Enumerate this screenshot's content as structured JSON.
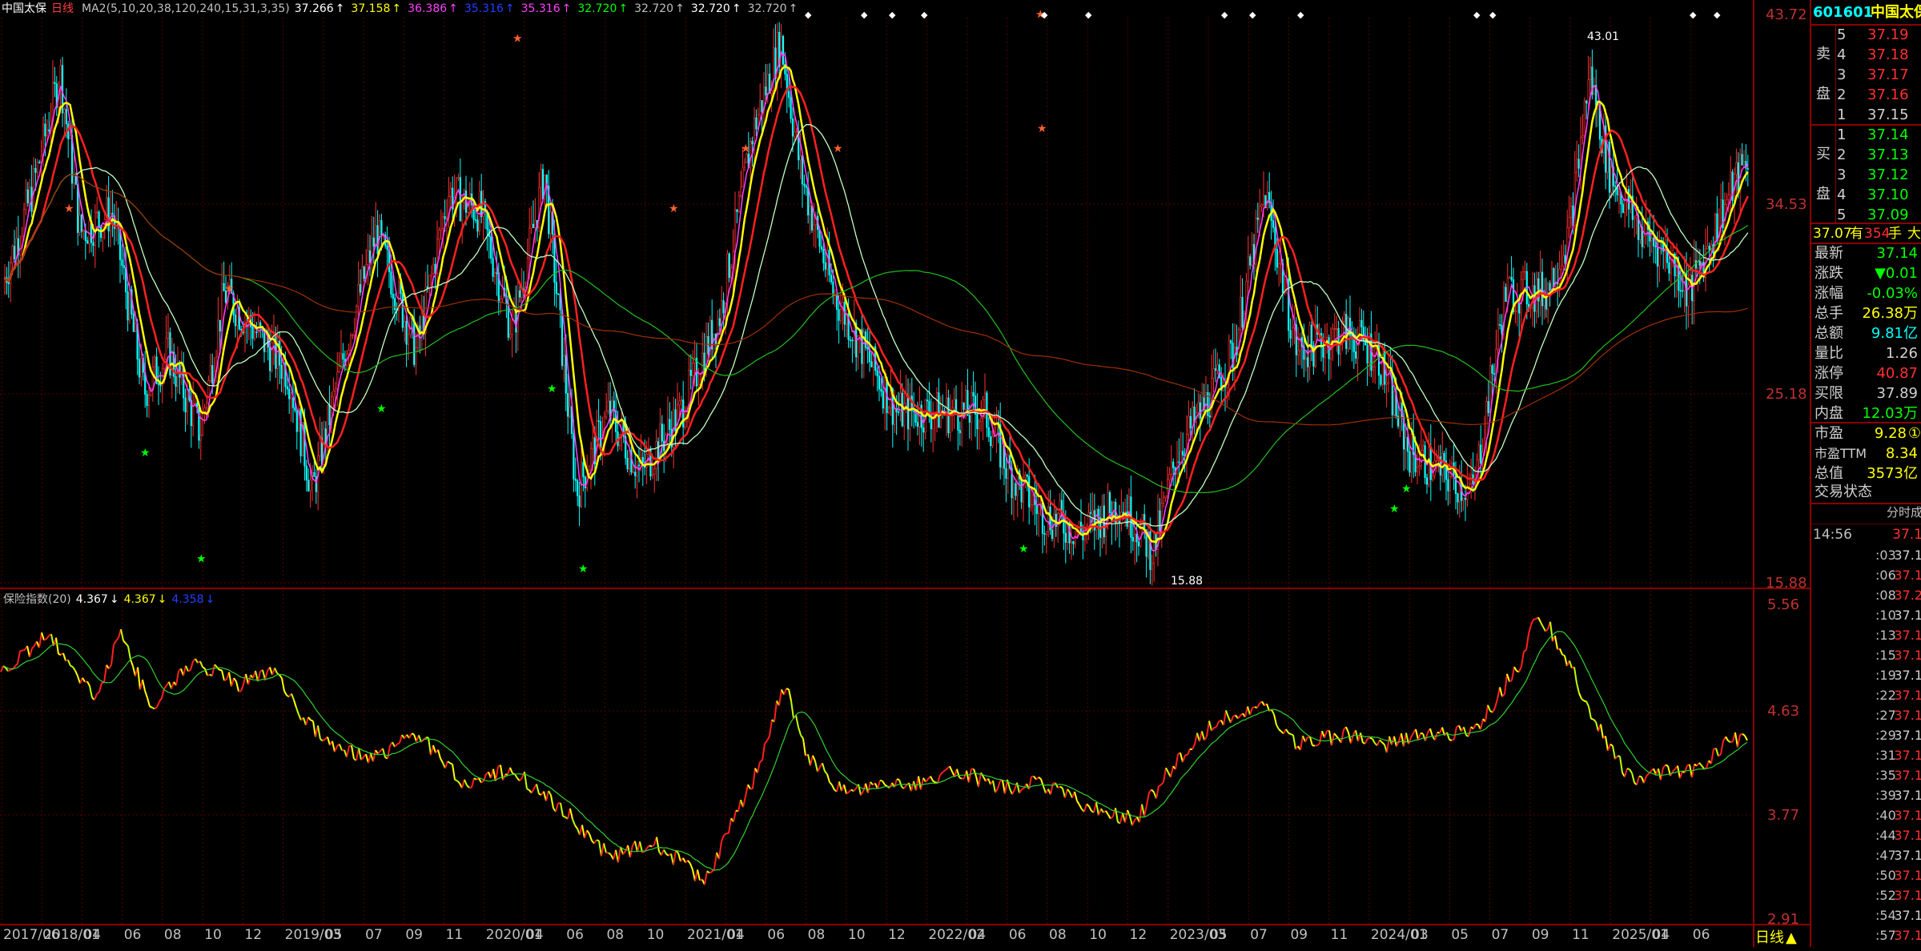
{
  "header": {
    "stock_name": "中国太保",
    "period": "日线",
    "ma_label": "MA2(5,10,20,38,120,240,15,31,3,35)",
    "ma_values": [
      {
        "value": "37.266",
        "color": "#ffffff"
      },
      {
        "value": "37.158",
        "color": "#ffff00"
      },
      {
        "value": "36.386",
        "color": "#ff40ff"
      },
      {
        "value": "35.316",
        "color": "#2040ff"
      },
      {
        "value": "35.316",
        "color": "#ff40ff"
      },
      {
        "value": "32.720",
        "color": "#00ff00"
      },
      {
        "value": "32.720",
        "color": "#c0c0c0"
      },
      {
        "value": "32.720",
        "color": "#ffffff"
      },
      {
        "value": "32.720",
        "color": "#c0c0c0"
      }
    ]
  },
  "price_axis": {
    "labels": [
      "43.72",
      "34.53",
      "25.18",
      "15.88"
    ]
  },
  "annotations": {
    "high": "43.01",
    "low": "15.88"
  },
  "index_panel": {
    "title": "保险指数(20)",
    "values": [
      {
        "value": "4.367",
        "color": "#ffffff"
      },
      {
        "value": "4.367",
        "color": "#ffff00"
      },
      {
        "value": "4.358",
        "color": "#2040ff"
      }
    ],
    "axis_labels": [
      "5.56",
      "4.63",
      "3.77",
      "2.91"
    ]
  },
  "x_axis": {
    "labels": [
      "2017/06",
      "2018/01",
      "04",
      "06",
      "08",
      "10",
      "12",
      "2019/03",
      "05",
      "07",
      "09",
      "11",
      "2020/01",
      "04",
      "06",
      "08",
      "10",
      "2021/01",
      "04",
      "06",
      "08",
      "10",
      "12",
      "2022/02",
      "04",
      "06",
      "08",
      "10",
      "12",
      "2023/03",
      "05",
      "07",
      "09",
      "11",
      "2024/01",
      "03",
      "05",
      "07",
      "09",
      "11",
      "2025/01",
      "04",
      "06"
    ]
  },
  "period_toggle": "日线",
  "quote": {
    "code": "601601",
    "name": "中国太保",
    "sell_label": [
      "卖",
      "盘"
    ],
    "buy_label": [
      "买",
      "盘"
    ],
    "sells": [
      {
        "level": "5",
        "price": "37.19"
      },
      {
        "level": "4",
        "price": "37.18"
      },
      {
        "level": "3",
        "price": "37.17"
      },
      {
        "level": "2",
        "price": "37.16"
      },
      {
        "level": "1",
        "price": "37.15"
      }
    ],
    "buys": [
      {
        "level": "1",
        "price": "37.14"
      },
      {
        "level": "2",
        "price": "37.13"
      },
      {
        "level": "3",
        "price": "37.12"
      },
      {
        "level": "4",
        "price": "37.10"
      },
      {
        "level": "5",
        "price": "37.09"
      }
    ],
    "summary_line": {
      "price": "37.07",
      "mid": "有",
      "vol": "354",
      "unit": "手",
      "tail": "大"
    },
    "fields": [
      {
        "k": "最新",
        "v": "37.14",
        "c": "#00ff00"
      },
      {
        "k": "涨跌",
        "v": "▼0.01",
        "c": "#00ff00"
      },
      {
        "k": "涨幅",
        "v": "-0.03%",
        "c": "#00ff00"
      },
      {
        "k": "总手",
        "v": "26.38万",
        "c": "#ffff00"
      },
      {
        "k": "总额",
        "v": "9.81亿",
        "c": "#00ffff"
      },
      {
        "k": "量比",
        "v": "1.26",
        "c": "#d0d0d0"
      },
      {
        "k": "涨停",
        "v": "40.87",
        "c": "#ff3030"
      },
      {
        "k": "买限",
        "v": "37.89",
        "c": "#d0d0d0"
      },
      {
        "k": "内盘",
        "v": "12.03万",
        "c": "#00ff00"
      }
    ],
    "fields2": [
      {
        "k": "市盈",
        "v": "9.28",
        "c": "#ffff00",
        "icon": "①"
      },
      {
        "k": "市盈TTM",
        "v": "8.34",
        "c": "#ffff00"
      },
      {
        "k": "总值",
        "v": "3573亿",
        "c": "#ffff00"
      }
    ],
    "status": "交易状态",
    "ticks_header": "分时成",
    "ticks": [
      {
        "t": "14:56",
        "p": "37.1"
      },
      {
        "t": ":03",
        "p": "37.1"
      },
      {
        "t": ":06",
        "p": "37.1"
      },
      {
        "t": ":08",
        "p": "37.2"
      },
      {
        "t": ":10",
        "p": "37.1"
      },
      {
        "t": ":13",
        "p": "37.1"
      },
      {
        "t": ":15",
        "p": "37.1"
      },
      {
        "t": ":19",
        "p": "37.1"
      },
      {
        "t": ":22",
        "p": "37.1"
      },
      {
        "t": ":27",
        "p": "37.1"
      },
      {
        "t": ":29",
        "p": "37.1"
      },
      {
        "t": ":31",
        "p": "37.1"
      },
      {
        "t": ":35",
        "p": "37.1"
      },
      {
        "t": ":39",
        "p": "37.1"
      },
      {
        "t": ":40",
        "p": "37.1"
      },
      {
        "t": ":44",
        "p": "37.1"
      },
      {
        "t": ":47",
        "p": "37.1"
      },
      {
        "t": ":50",
        "p": "37.1"
      },
      {
        "t": ":52",
        "p": "37.1"
      },
      {
        "t": ":54",
        "p": "37.1"
      },
      {
        "t": ":57",
        "p": "37.1"
      }
    ]
  },
  "colors": {
    "up": "#ff3030",
    "down": "#00ff00",
    "grid": "#6b0000",
    "axis": "#8b0000"
  }
}
